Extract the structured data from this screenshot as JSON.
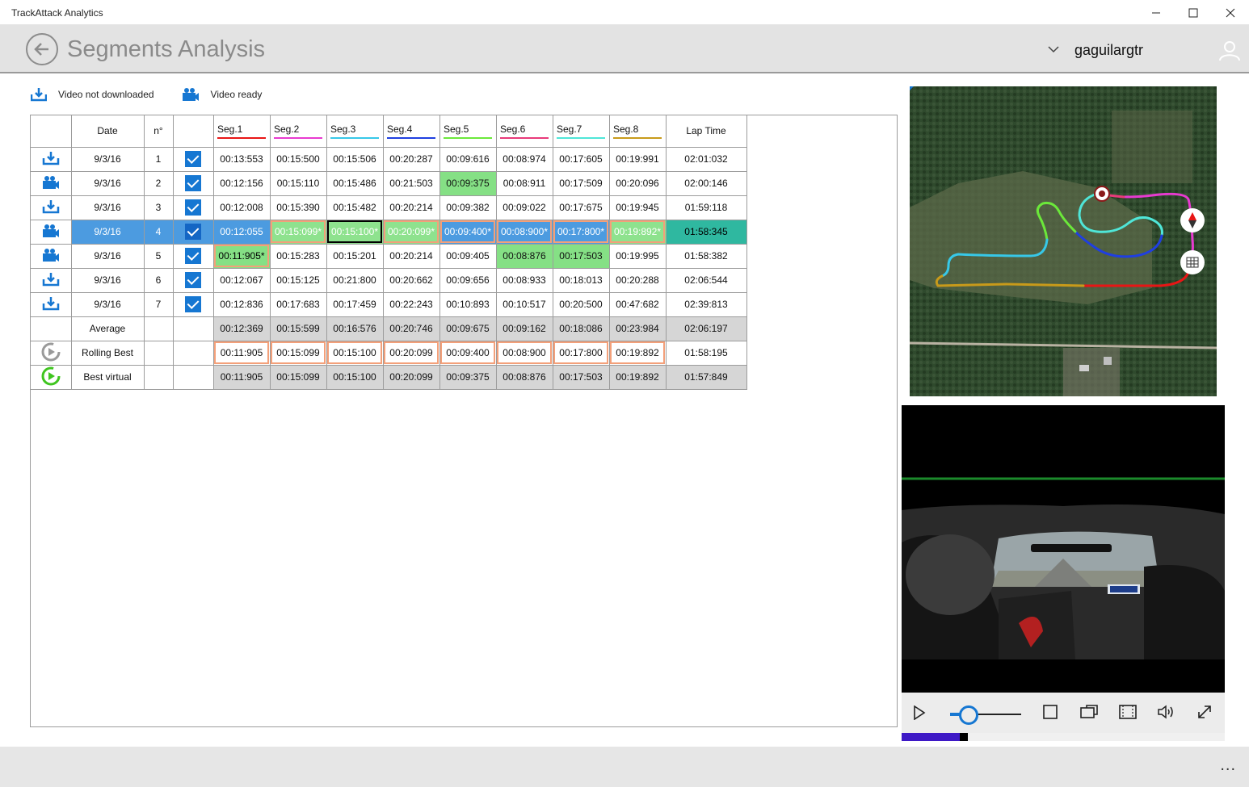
{
  "window": {
    "title": "TrackAttack Analytics"
  },
  "header": {
    "page_title": "Segments Analysis",
    "username": "gaguilargtr"
  },
  "legend": {
    "not_downloaded": "Video not downloaded",
    "ready": "Video ready"
  },
  "table": {
    "headers": {
      "date": "Date",
      "num": "n°",
      "lap": "Lap Time"
    },
    "segments": [
      {
        "label": "Seg.1",
        "color": "#e81515"
      },
      {
        "label": "Seg.2",
        "color": "#e83ad0"
      },
      {
        "label": "Seg.3",
        "color": "#37c8e8"
      },
      {
        "label": "Seg.4",
        "color": "#1f3fe0"
      },
      {
        "label": "Seg.5",
        "color": "#6be83a"
      },
      {
        "label": "Seg.6",
        "color": "#e83a7a"
      },
      {
        "label": "Seg.7",
        "color": "#4fe6d8"
      },
      {
        "label": "Seg.8",
        "color": "#c89a1a"
      }
    ],
    "laps": [
      {
        "video": "download-icon",
        "date": "9/3/16",
        "n": "1",
        "segs": [
          "00:13:553",
          "00:15:500",
          "00:15:506",
          "00:20:287",
          "00:09:616",
          "00:08:974",
          "00:17:605",
          "00:19:991"
        ],
        "lap": "02:01:032"
      },
      {
        "video": "camera-icon",
        "date": "9/3/16",
        "n": "2",
        "segs": [
          "00:12:156",
          "00:15:110",
          "00:15:486",
          "00:21:503",
          "00:09:375",
          "00:08:911",
          "00:17:509",
          "00:20:096"
        ],
        "lap": "02:00:146"
      },
      {
        "video": "download-icon",
        "date": "9/3/16",
        "n": "3",
        "segs": [
          "00:12:008",
          "00:15:390",
          "00:15:482",
          "00:20:214",
          "00:09:382",
          "00:09:022",
          "00:17:675",
          "00:19:945"
        ],
        "lap": "01:59:118"
      },
      {
        "video": "camera-icon",
        "date": "9/3/16",
        "n": "4",
        "segs": [
          "00:12:055",
          "00:15:099*",
          "00:15:100*",
          "00:20:099*",
          "00:09:400*",
          "00:08:900*",
          "00:17:800*",
          "00:19:892*"
        ],
        "lap": "01:58:345"
      },
      {
        "video": "camera-icon",
        "date": "9/3/16",
        "n": "5",
        "segs": [
          "00:11:905*",
          "00:15:283",
          "00:15:201",
          "00:20:214",
          "00:09:405",
          "00:08:876",
          "00:17:503",
          "00:19:995"
        ],
        "lap": "01:58:382"
      },
      {
        "video": "download-icon",
        "date": "9/3/16",
        "n": "6",
        "segs": [
          "00:12:067",
          "00:15:125",
          "00:21:800",
          "00:20:662",
          "00:09:656",
          "00:08:933",
          "00:18:013",
          "00:20:288"
        ],
        "lap": "02:06:544"
      },
      {
        "video": "download-icon",
        "date": "9/3/16",
        "n": "7",
        "segs": [
          "00:12:836",
          "00:17:683",
          "00:17:459",
          "00:22:243",
          "00:10:893",
          "00:10:517",
          "00:20:500",
          "00:47:682"
        ],
        "lap": "02:39:813"
      }
    ],
    "average": {
      "label": "Average",
      "segs": [
        "00:12:369",
        "00:15:599",
        "00:16:576",
        "00:20:746",
        "00:09:675",
        "00:09:162",
        "00:18:086",
        "00:23:984"
      ],
      "lap": "02:06:197"
    },
    "rolling": {
      "label": "Rolling Best",
      "segs": [
        "00:11:905",
        "00:15:099",
        "00:15:100",
        "00:20:099",
        "00:09:400",
        "00:08:900",
        "00:17:800",
        "00:19:892"
      ],
      "lap": "01:58:195"
    },
    "virtual": {
      "label": "Best virtual",
      "segs": [
        "00:11:905",
        "00:15:099",
        "00:15:100",
        "00:20:099",
        "00:09:375",
        "00:08:876",
        "00:17:503",
        "00:19:892"
      ],
      "lap": "01:57:849"
    }
  },
  "player": {
    "progress": 0.18
  },
  "bottom": {
    "more": "..."
  }
}
